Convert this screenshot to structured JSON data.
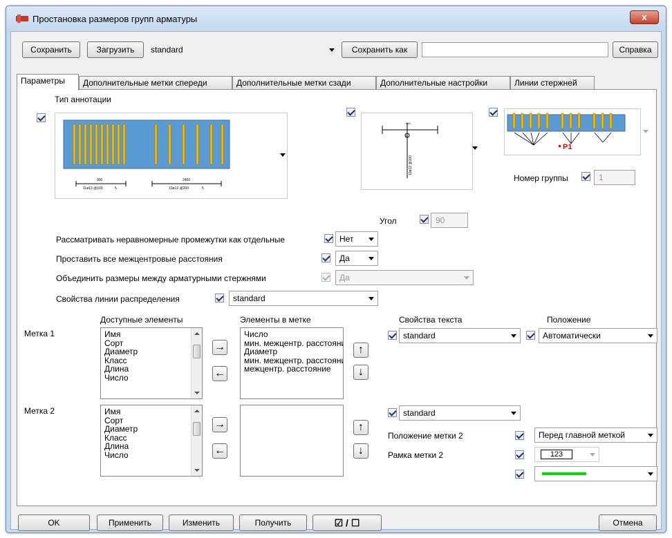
{
  "window": {
    "title": "Простановка размеров групп арматуры",
    "close_symbol": "x"
  },
  "toolbar": {
    "save_label": "Сохранить",
    "load_label": "Загрузить",
    "preset_value": "standard",
    "save_as_label": "Сохранить как",
    "save_as_value": "",
    "help_label": "Справка"
  },
  "tabs": [
    {
      "label": "Параметры"
    },
    {
      "label": "Дополнительные метки спереди"
    },
    {
      "label": "Дополнительные метки сзади"
    },
    {
      "label": "Дополнительные настройки"
    },
    {
      "label": "Линии стержней"
    }
  ],
  "params": {
    "annotation_type_label": "Тип аннотации",
    "preview_main": {
      "dim_left_top": "900",
      "dim_left": "11ø12 @100",
      "dim_left_mark": "5",
      "dim_right_top": "2400",
      "dim_right": "10ø12 @200",
      "dim_right_mark": "5"
    },
    "preview_vertical": {
      "dim_top": "900",
      "text": "10ø12 @100",
      "mark": "5"
    },
    "preview_fan": {
      "label": "P1"
    },
    "angle_label": "Угол",
    "angle_value": "90",
    "group_number_label": "Номер группы",
    "group_number_value": "1",
    "uneven_label": "Рассматривать неравномерные промежутки как отдельные",
    "uneven_value": "Нет",
    "all_spacings_label": "Проставить все межцентровые расстояния",
    "all_spacings_value": "Да",
    "merge_label": "Объединить размеры между арматурными стержнями",
    "merge_value": "Да",
    "distribution_label": "Свойства линии распределения",
    "distribution_value": "standard"
  },
  "columns": {
    "available": "Доступные элементы",
    "in_mark": "Элементы в метке",
    "text_props": "Свойства текста",
    "position": "Положение"
  },
  "mark1": {
    "label": "Метка 1",
    "available": [
      "Имя",
      "Сорт",
      "Диаметр",
      "Класс",
      "Длина",
      "Число"
    ],
    "in_mark": [
      "Число",
      "мин. межцентр. расстояние",
      "Диаметр",
      "мин. межцентр. расстояние",
      "межцентр. расстояние"
    ],
    "text_value": "standard",
    "position_value": "Автоматически"
  },
  "mark2": {
    "label": "Метка 2",
    "available": [
      "Имя",
      "Сорт",
      "Диаметр",
      "Класс",
      "Длина",
      "Число"
    ],
    "in_mark": [],
    "text_value": "standard",
    "position_label": "Положение метки 2",
    "position_value": "Перед главной меткой",
    "frame_label": "Рамка метки 2",
    "frame_value": "123"
  },
  "colors": {
    "line_color": "#00dd00",
    "rebar": "#ffc000",
    "beam": "#5b9bd5"
  },
  "bottom": {
    "ok": "OK",
    "apply": "Применить",
    "modify": "Изменить",
    "get": "Получить",
    "toggle": "☑ / ☐",
    "cancel": "Отмена"
  }
}
